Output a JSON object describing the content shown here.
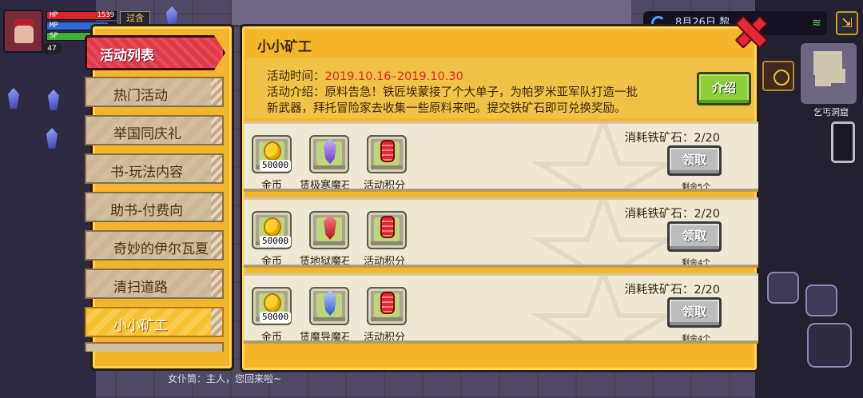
{
  "hud": {
    "hp_label": "HP",
    "hp_value": "1539",
    "mp_label": "MP",
    "sp_label": "SP",
    "level": "47",
    "tag": "过含",
    "date_text": "8月26日 黎",
    "location": "乞丐洞窟"
  },
  "chat": "女仆筒：主人，您回来啦~",
  "menu": {
    "header": "活动列表",
    "items": [
      {
        "label": "热门活动"
      },
      {
        "label": "举国同庆礼"
      },
      {
        "label": "书-玩法内容"
      },
      {
        "label": "助书-付费向"
      },
      {
        "label": "奇妙的伊尔瓦夏"
      },
      {
        "label": "清扫道路"
      },
      {
        "label": "小小矿工"
      }
    ]
  },
  "activity": {
    "title": "小小矿工",
    "time_label": "活动时间：",
    "time_value": "2019.10.16–2019.10.30",
    "intro_line1": "活动介绍：原料告急！铁匠埃蒙接了个大单子，为帕罗米亚军队打造一批",
    "intro_line2": "新武器，拜托冒险家去收集一些原料来吧。提交铁矿石即可兑换奖励。",
    "intro_button": "介绍"
  },
  "rewards": [
    {
      "cost": "消耗铁矿石：2/20",
      "claim": "领取",
      "remaining": "剩余5个",
      "items": [
        {
          "label": "金币",
          "qty": "50000",
          "icon": "coin-icon"
        },
        {
          "label": "赁极寒魔石",
          "icon": "ice-crystal-icon"
        },
        {
          "label": "活动积分",
          "icon": "event-point-icon"
        }
      ]
    },
    {
      "cost": "消耗铁矿石：2/20",
      "claim": "领取",
      "remaining": "剩余4个",
      "items": [
        {
          "label": "金币",
          "qty": "50000",
          "icon": "coin-icon"
        },
        {
          "label": "赁地狱魔石",
          "icon": "hell-crystal-icon"
        },
        {
          "label": "活动积分",
          "icon": "event-point-icon"
        }
      ]
    },
    {
      "cost": "消耗铁矿石：2/20",
      "claim": "领取",
      "remaining": "剩余4个",
      "items": [
        {
          "label": "金币",
          "qty": "50000",
          "icon": "coin-icon"
        },
        {
          "label": "赁魔导魔石",
          "icon": "magic-crystal-icon"
        },
        {
          "label": "活动积分",
          "icon": "event-point-icon"
        }
      ]
    }
  ],
  "colors": {
    "panel": "#f5b62c",
    "header_red": "#e0394a",
    "date_red": "#d8262a",
    "intro_green": "#8ccf3a"
  }
}
